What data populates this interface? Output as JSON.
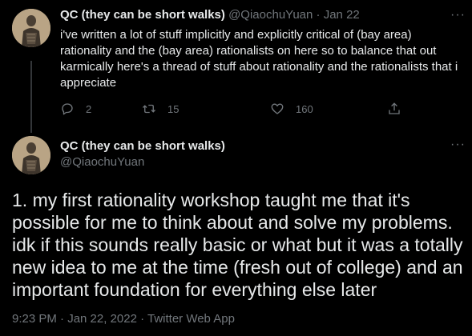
{
  "tweet1": {
    "display_name": "QC (they can be short walks)",
    "handle": "@QiaochuYuan",
    "separator": "·",
    "date": "Jan 22",
    "text": "i've written a lot of stuff implicitly and explicitly critical of (bay area) rationality and the (bay area) rationalists on here so to balance that out karmically here's a thread of stuff about rationality and the rationalists that i appreciate",
    "more_label": "···",
    "replies": "2",
    "retweets": "15",
    "likes": "160"
  },
  "tweet2": {
    "display_name": "QC (they can be short walks)",
    "handle": "@QiaochuYuan",
    "more_label": "···",
    "text": "1. my first rationality workshop taught me that it's possible for me to think about and solve my problems. idk if this sounds really basic or what but it was a totally new idea to me at the time (fresh out of college) and an important foundation for everything else later",
    "timestamp": "9:23 PM · Jan 22, 2022 · Twitter Web App"
  },
  "icons": {
    "reply": "reply-icon",
    "retweet": "retweet-icon",
    "like": "heart-icon",
    "share": "share-icon",
    "more": "more-icon"
  },
  "colors": {
    "background": "#000000",
    "text": "#e7e9ea",
    "muted": "#71767b",
    "thread_line": "#333639"
  }
}
